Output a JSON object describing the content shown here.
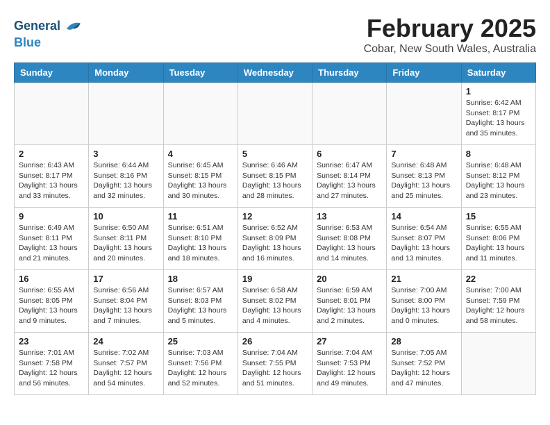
{
  "logo": {
    "line1": "General",
    "line2": "Blue"
  },
  "title": "February 2025",
  "subtitle": "Cobar, New South Wales, Australia",
  "headers": [
    "Sunday",
    "Monday",
    "Tuesday",
    "Wednesday",
    "Thursday",
    "Friday",
    "Saturday"
  ],
  "weeks": [
    [
      {
        "day": "",
        "info": ""
      },
      {
        "day": "",
        "info": ""
      },
      {
        "day": "",
        "info": ""
      },
      {
        "day": "",
        "info": ""
      },
      {
        "day": "",
        "info": ""
      },
      {
        "day": "",
        "info": ""
      },
      {
        "day": "1",
        "info": "Sunrise: 6:42 AM\nSunset: 8:17 PM\nDaylight: 13 hours\nand 35 minutes."
      }
    ],
    [
      {
        "day": "2",
        "info": "Sunrise: 6:43 AM\nSunset: 8:17 PM\nDaylight: 13 hours\nand 33 minutes."
      },
      {
        "day": "3",
        "info": "Sunrise: 6:44 AM\nSunset: 8:16 PM\nDaylight: 13 hours\nand 32 minutes."
      },
      {
        "day": "4",
        "info": "Sunrise: 6:45 AM\nSunset: 8:15 PM\nDaylight: 13 hours\nand 30 minutes."
      },
      {
        "day": "5",
        "info": "Sunrise: 6:46 AM\nSunset: 8:15 PM\nDaylight: 13 hours\nand 28 minutes."
      },
      {
        "day": "6",
        "info": "Sunrise: 6:47 AM\nSunset: 8:14 PM\nDaylight: 13 hours\nand 27 minutes."
      },
      {
        "day": "7",
        "info": "Sunrise: 6:48 AM\nSunset: 8:13 PM\nDaylight: 13 hours\nand 25 minutes."
      },
      {
        "day": "8",
        "info": "Sunrise: 6:48 AM\nSunset: 8:12 PM\nDaylight: 13 hours\nand 23 minutes."
      }
    ],
    [
      {
        "day": "9",
        "info": "Sunrise: 6:49 AM\nSunset: 8:11 PM\nDaylight: 13 hours\nand 21 minutes."
      },
      {
        "day": "10",
        "info": "Sunrise: 6:50 AM\nSunset: 8:11 PM\nDaylight: 13 hours\nand 20 minutes."
      },
      {
        "day": "11",
        "info": "Sunrise: 6:51 AM\nSunset: 8:10 PM\nDaylight: 13 hours\nand 18 minutes."
      },
      {
        "day": "12",
        "info": "Sunrise: 6:52 AM\nSunset: 8:09 PM\nDaylight: 13 hours\nand 16 minutes."
      },
      {
        "day": "13",
        "info": "Sunrise: 6:53 AM\nSunset: 8:08 PM\nDaylight: 13 hours\nand 14 minutes."
      },
      {
        "day": "14",
        "info": "Sunrise: 6:54 AM\nSunset: 8:07 PM\nDaylight: 13 hours\nand 13 minutes."
      },
      {
        "day": "15",
        "info": "Sunrise: 6:55 AM\nSunset: 8:06 PM\nDaylight: 13 hours\nand 11 minutes."
      }
    ],
    [
      {
        "day": "16",
        "info": "Sunrise: 6:55 AM\nSunset: 8:05 PM\nDaylight: 13 hours\nand 9 minutes."
      },
      {
        "day": "17",
        "info": "Sunrise: 6:56 AM\nSunset: 8:04 PM\nDaylight: 13 hours\nand 7 minutes."
      },
      {
        "day": "18",
        "info": "Sunrise: 6:57 AM\nSunset: 8:03 PM\nDaylight: 13 hours\nand 5 minutes."
      },
      {
        "day": "19",
        "info": "Sunrise: 6:58 AM\nSunset: 8:02 PM\nDaylight: 13 hours\nand 4 minutes."
      },
      {
        "day": "20",
        "info": "Sunrise: 6:59 AM\nSunset: 8:01 PM\nDaylight: 13 hours\nand 2 minutes."
      },
      {
        "day": "21",
        "info": "Sunrise: 7:00 AM\nSunset: 8:00 PM\nDaylight: 13 hours\nand 0 minutes."
      },
      {
        "day": "22",
        "info": "Sunrise: 7:00 AM\nSunset: 7:59 PM\nDaylight: 12 hours\nand 58 minutes."
      }
    ],
    [
      {
        "day": "23",
        "info": "Sunrise: 7:01 AM\nSunset: 7:58 PM\nDaylight: 12 hours\nand 56 minutes."
      },
      {
        "day": "24",
        "info": "Sunrise: 7:02 AM\nSunset: 7:57 PM\nDaylight: 12 hours\nand 54 minutes."
      },
      {
        "day": "25",
        "info": "Sunrise: 7:03 AM\nSunset: 7:56 PM\nDaylight: 12 hours\nand 52 minutes."
      },
      {
        "day": "26",
        "info": "Sunrise: 7:04 AM\nSunset: 7:55 PM\nDaylight: 12 hours\nand 51 minutes."
      },
      {
        "day": "27",
        "info": "Sunrise: 7:04 AM\nSunset: 7:53 PM\nDaylight: 12 hours\nand 49 minutes."
      },
      {
        "day": "28",
        "info": "Sunrise: 7:05 AM\nSunset: 7:52 PM\nDaylight: 12 hours\nand 47 minutes."
      },
      {
        "day": "",
        "info": ""
      }
    ]
  ]
}
